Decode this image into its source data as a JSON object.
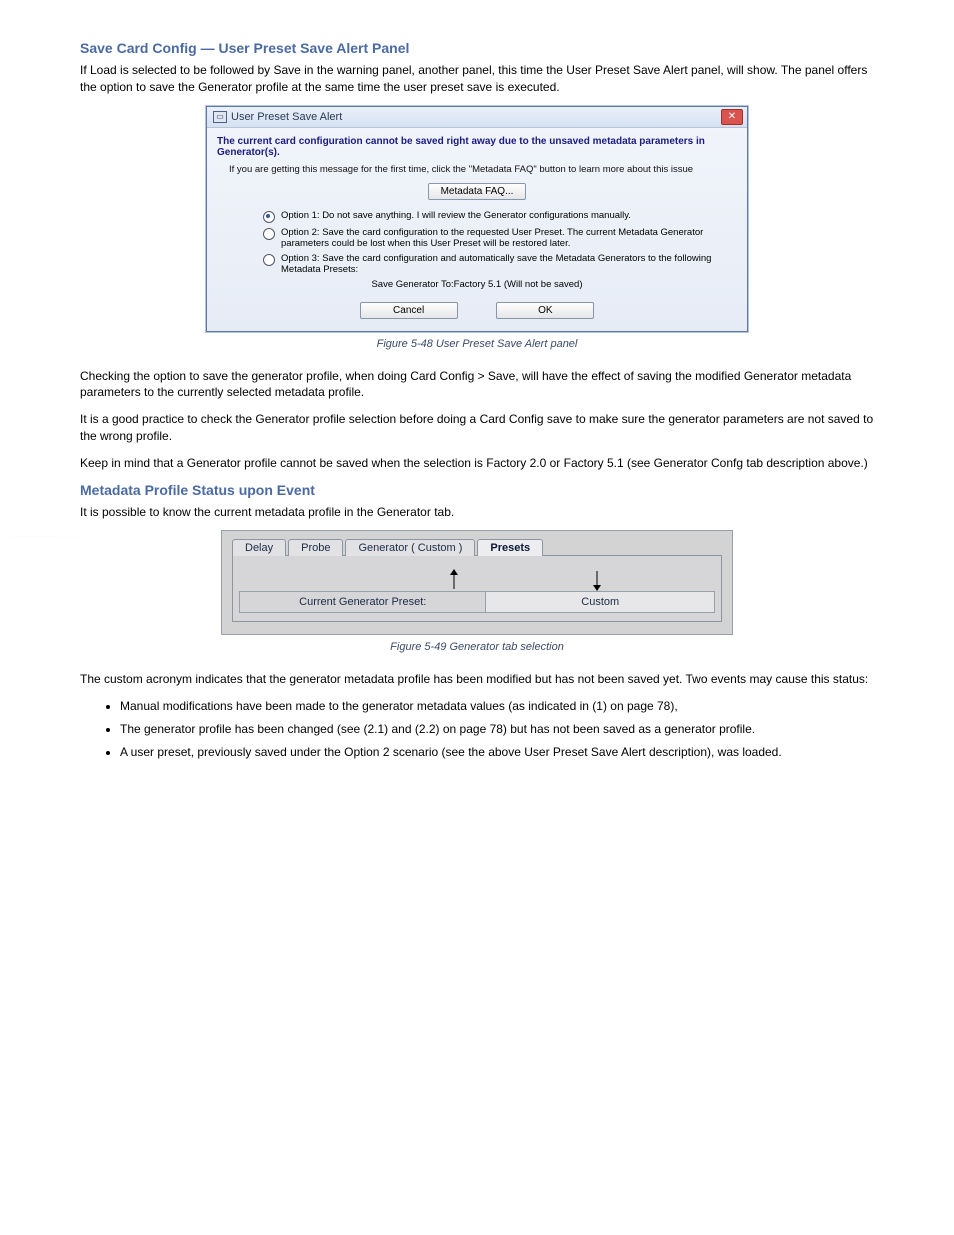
{
  "doc": {
    "section1": {
      "title": "Save Card Config — User Preset Save Alert Panel",
      "p1": "If Load is selected to be followed by Save in the warning panel, another panel, this time the User Preset Save Alert panel, will show. The panel offers the option to save the Generator profile at the same time the user preset save is executed."
    },
    "dialog": {
      "title": "User Preset Save Alert",
      "heading": "The current card configuration cannot be saved right away due to the unsaved metadata parameters in Generator(s).",
      "sub": "If you are getting this message for the first time, click the \"Metadata FAQ\" button to learn more about this issue",
      "faq_btn": "Metadata FAQ...",
      "opt1": "Option 1: Do not save anything. I will review the Generator configurations manually.",
      "opt2": "Option 2: Save the card configuration to the requested User Preset. The current Metadata Generator parameters could be lost when this User Preset will be restored later.",
      "opt3": "Option 3: Save the card configuration and automatically save the Metadata Generators to the following Metadata Presets:",
      "save_line": "Save Generator To:Factory 5.1 (Will not be saved)",
      "cancel": "Cancel",
      "ok": "OK"
    },
    "figcap1": "Figure 5-48 User Preset Save Alert panel",
    "section2": {
      "p1": "Checking the option to save the generator profile, when doing Card Config > Save, will have the effect of saving the modified Generator metadata parameters to the currently selected metadata profile.",
      "p2": "It is a good practice to check the Generator profile selection before doing a Card Config save to make sure the generator parameters are not saved to the wrong profile.",
      "p3": "Keep in mind that a Generator profile cannot be saved when the selection is Factory 2.0 or Factory 5.1 (see Generator Confg tab description above.)"
    },
    "section3": {
      "title": "Metadata Profile Status upon Event",
      "lead": "It is possible to know the current metadata profile in the Generator tab.",
      "tabs": {
        "delay": "Delay",
        "probe": "Probe",
        "generator": "Generator ( Custom )",
        "presets": "Presets",
        "cgp_label": "Current Generator Preset:",
        "cgp_value": "Custom"
      },
      "figcap2": "Figure 5-49 Generator tab selection",
      "explain": "The custom acronym indicates that the generator metadata profile has been modified but has not been saved yet. Two events may cause this status:",
      "bullets": {
        "b1": "Manual modifications have been made to the generator metadata values (as indicated in (1) on page 78),",
        "b2": "The generator profile has been changed (see (2.1) and (2.2) on page 78) but has not been saved as a generator profile.",
        "b3": "A user preset, previously saved under the Option 2 scenario (see the above User Preset Save Alert description), was loaded."
      }
    }
  }
}
